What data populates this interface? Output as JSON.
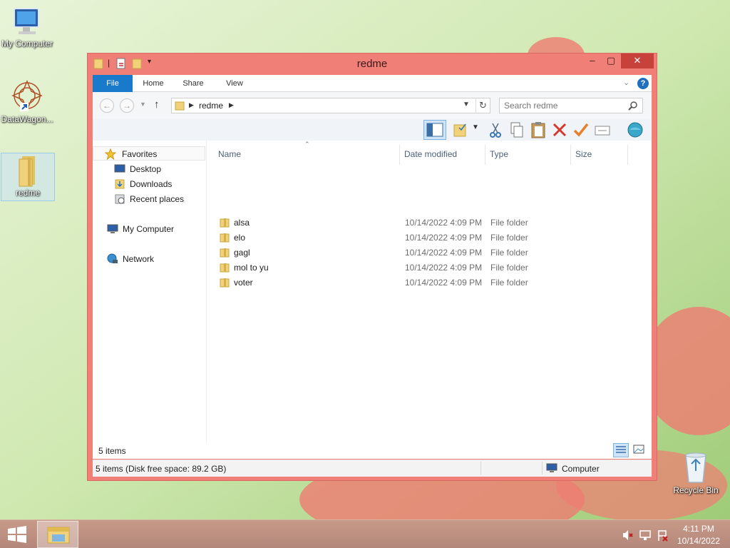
{
  "desktop": {
    "icons": [
      {
        "label": "My Computer"
      },
      {
        "label": "DataWagon..."
      },
      {
        "label": "redme"
      },
      {
        "label": "Recycle Bin"
      }
    ]
  },
  "window": {
    "title": "redme",
    "ribbon_tabs": [
      "File",
      "Home",
      "Share",
      "View"
    ],
    "address": {
      "path": "redme",
      "search_placeholder": "Search redme"
    },
    "nav_pane": {
      "favorites": "Favorites",
      "favorites_items": [
        "Desktop",
        "Downloads",
        "Recent places"
      ],
      "my_computer": "My Computer",
      "network": "Network"
    },
    "columns": [
      "Name",
      "Date modified",
      "Type",
      "Size"
    ],
    "files": [
      {
        "name": "alsa",
        "date": "10/14/2022 4:09 PM",
        "type": "File folder"
      },
      {
        "name": "elo",
        "date": "10/14/2022 4:09 PM",
        "type": "File folder"
      },
      {
        "name": "gagl",
        "date": "10/14/2022 4:09 PM",
        "type": "File folder"
      },
      {
        "name": "mol to yu",
        "date": "10/14/2022 4:09 PM",
        "type": "File folder"
      },
      {
        "name": "voter",
        "date": "10/14/2022 4:09 PM",
        "type": "File folder"
      }
    ],
    "items_count": "5 items",
    "status_text": "5 items (Disk free space: 89.2 GB)",
    "status_location": "Computer"
  },
  "taskbar": {
    "time": "4:11 PM",
    "date": "10/14/2022"
  },
  "colors": {
    "window_frame": "#f07f78",
    "close_button": "#c7423b",
    "file_tab": "#1979ca",
    "taskbar": "#b98d7f"
  },
  "icon_names": [
    "computer-icon",
    "datawagon-icon",
    "folder-icon",
    "recycle-bin-icon",
    "star-icon",
    "network-icon",
    "search-icon",
    "windows-logo-icon"
  ]
}
